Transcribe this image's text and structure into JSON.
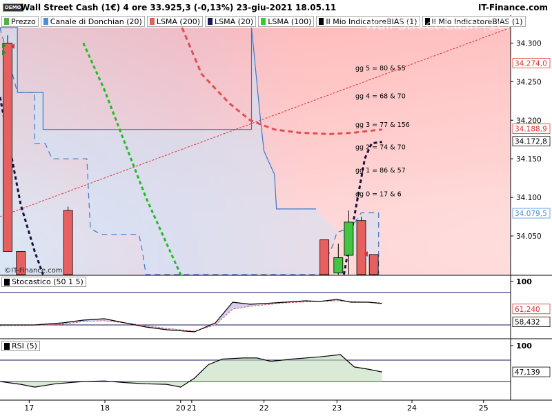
{
  "header": {
    "badge": "DEMO",
    "title": "Wall Street Cash (1€) 4 ore 33.925,3 (-0,13%) 23-giu-2021 18.05.11",
    "brand": "IT-Finance.com"
  },
  "watermark": "Wall Street Cash (1€)",
  "copyright": "©IT-Finance.com",
  "legend": [
    {
      "label": "Prezzo",
      "color": "#55b04b"
    },
    {
      "label": "Canale di Donchian (20)",
      "color": "#4a90d9"
    },
    {
      "label": "LSMA (200)",
      "color": "#e26060"
    },
    {
      "label": "LSMA (20)",
      "color": "#1a1a50"
    },
    {
      "label": "LSMA (100)",
      "color": "#33cc33"
    },
    {
      "label": "Il Mio IndicatoreBIAS (1)",
      "color": "#000000"
    },
    {
      "label": "Il Mio IndicatoreBIAS (1)",
      "color": "#000000"
    }
  ],
  "annotations": [
    {
      "text": "gg 5  = 80  & 55",
      "y": 34.268
    },
    {
      "text": "gg 4  = 68  & 70",
      "y": 34.232
    },
    {
      "text": "gg 3  = 77  & 156",
      "y": 34.195
    },
    {
      "text": "gg 2  = 74  & 70",
      "y": 34.166
    },
    {
      "text": "gg 1  = 86  & 57",
      "y": 34.136
    },
    {
      "text": "gg 0  = 17  & 6",
      "y": 34.105
    }
  ],
  "price_badges": [
    {
      "value": 34274.0,
      "label": "34.274,0",
      "color": "#e03030",
      "bg": "#ffffff"
    },
    {
      "value": 34188.9,
      "label": "34.188,9",
      "color": "#e03030",
      "bg": "#ffffff"
    },
    {
      "value": 34172.8,
      "label": "34.172,8",
      "color": "#000000",
      "bg": "#ffffff"
    },
    {
      "value": 34079.5,
      "label": "34.079,5",
      "color": "#4a90d9",
      "bg": "#ffffff"
    }
  ],
  "stoch_badges": [
    {
      "value": 61.24,
      "label": "61,240",
      "color": "#e03030"
    },
    {
      "value": 58.432,
      "label": "58,432",
      "color": "#000000"
    }
  ],
  "rsi_badges": [
    {
      "value": 47.139,
      "label": "47,139",
      "color": "#000000"
    }
  ],
  "chart_data": {
    "type": "candlestick",
    "price_axis": {
      "min": 34.0,
      "max": 34.32,
      "ticks": [
        34.05,
        34.1,
        34.15,
        34.2,
        34.25,
        34.3
      ],
      "tick_labels": [
        "34.050",
        "34.100",
        "34.150",
        "34.200",
        "34.250",
        "34.300"
      ]
    },
    "x_axis": {
      "min": 0,
      "max": 7.35,
      "ticks": [
        {
          "x": 0.42,
          "label": "17"
        },
        {
          "x": 1.51,
          "label": "18"
        },
        {
          "x": 2.6,
          "label": "20"
        },
        {
          "x": 2.76,
          "label": "21"
        },
        {
          "x": 3.8,
          "label": "22"
        },
        {
          "x": 4.85,
          "label": "23"
        },
        {
          "x": 5.93,
          "label": "24"
        },
        {
          "x": 6.96,
          "label": "25"
        }
      ]
    },
    "candles": [
      {
        "x": 0.11,
        "open": 34.3,
        "high": 34.31,
        "low": 34.03,
        "close": 34.03,
        "dir": "down"
      },
      {
        "x": 0.3,
        "open": 34.03,
        "high": 34.03,
        "low": 33.98,
        "close": 33.99,
        "dir": "down"
      },
      {
        "x": 0.98,
        "open": 34.083,
        "high": 34.088,
        "low": 33.98,
        "close": 34.0,
        "dir": "down"
      },
      {
        "x": 4.67,
        "open": 34.045,
        "high": 34.045,
        "low": 33.99,
        "close": 34.0,
        "dir": "down"
      },
      {
        "x": 4.87,
        "open": 34.002,
        "high": 34.04,
        "low": 33.99,
        "close": 34.022,
        "dir": "up"
      },
      {
        "x": 5.02,
        "open": 34.025,
        "high": 34.083,
        "low": 34.0,
        "close": 34.068,
        "dir": "up"
      },
      {
        "x": 5.2,
        "open": 34.07,
        "high": 34.075,
        "low": 33.99,
        "close": 33.995,
        "dir": "down"
      },
      {
        "x": 5.38,
        "open": 34.026,
        "high": 34.026,
        "low": 33.99,
        "close": 34.0,
        "dir": "down"
      }
    ],
    "donchian_upper": [
      [
        0.0,
        34.32
      ],
      [
        0.25,
        34.32
      ],
      [
        0.25,
        34.236
      ],
      [
        0.4,
        34.236
      ],
      [
        0.4,
        34.236
      ],
      [
        0.62,
        34.236
      ],
      [
        0.62,
        34.188
      ],
      [
        1.22,
        34.188
      ],
      [
        1.22,
        34.188
      ],
      [
        3.62,
        34.188
      ],
      [
        3.62,
        34.32
      ],
      [
        3.62,
        34.32
      ],
      [
        3.75,
        34.2
      ],
      [
        3.8,
        34.16
      ],
      [
        3.95,
        34.13
      ],
      [
        3.98,
        34.085
      ],
      [
        4.55,
        34.085
      ],
      [
        4.55,
        34.085
      ]
    ],
    "donchian_lower": [
      [
        0.0,
        34.32
      ],
      [
        0.25,
        34.236
      ],
      [
        0.25,
        34.236
      ],
      [
        0.5,
        34.236
      ],
      [
        0.5,
        34.17
      ],
      [
        0.65,
        34.17
      ],
      [
        0.75,
        34.15
      ],
      [
        1.25,
        34.15
      ],
      [
        1.3,
        34.06
      ],
      [
        1.45,
        34.052
      ],
      [
        2.0,
        34.052
      ],
      [
        2.05,
        34.03
      ],
      [
        2.1,
        34.0
      ],
      [
        4.6,
        34.0
      ],
      [
        4.8,
        34.04
      ],
      [
        4.85,
        34.055
      ],
      [
        5.05,
        34.06
      ],
      [
        5.2,
        34.08
      ],
      [
        5.45,
        34.08
      ],
      [
        5.45,
        34.0
      ]
    ],
    "lsma_200": [
      [
        2.62,
        34.32
      ],
      [
        2.9,
        34.26
      ],
      [
        3.3,
        34.222
      ],
      [
        3.6,
        34.2
      ],
      [
        3.95,
        34.188
      ],
      [
        4.3,
        34.184
      ],
      [
        4.75,
        34.182
      ],
      [
        5.1,
        34.184
      ],
      [
        5.5,
        34.188
      ]
    ],
    "lsma_20": [
      [
        0.0,
        34.23
      ],
      [
        0.15,
        34.16
      ],
      [
        0.3,
        34.09
      ],
      [
        0.5,
        34.03
      ],
      [
        0.62,
        34.0
      ]
    ],
    "lsma_20_tail": [
      [
        4.95,
        34.0
      ],
      [
        5.05,
        34.05
      ],
      [
        5.15,
        34.1
      ],
      [
        5.25,
        34.15
      ],
      [
        5.35,
        34.17
      ],
      [
        5.5,
        34.172
      ]
    ],
    "lsma_100": [
      [
        1.2,
        34.3
      ],
      [
        1.5,
        34.24
      ],
      [
        1.8,
        34.17
      ],
      [
        2.1,
        34.1
      ],
      [
        2.4,
        34.04
      ],
      [
        2.6,
        34.0
      ]
    ],
    "bias_trend": [
      [
        0.0,
        34.075
      ],
      [
        7.35,
        34.32
      ]
    ],
    "stochastic": {
      "title": "Stocastico (50 1 5)",
      "levels": [
        20,
        80
      ],
      "axis_label": "100",
      "k": [
        [
          0.0,
          45
        ],
        [
          0.5,
          45
        ],
        [
          0.9,
          48
        ],
        [
          1.2,
          52
        ],
        [
          1.5,
          54
        ],
        [
          1.8,
          48
        ],
        [
          2.1,
          42
        ],
        [
          2.4,
          38
        ],
        [
          2.8,
          35
        ],
        [
          3.1,
          48
        ],
        [
          3.35,
          78
        ],
        [
          3.6,
          75
        ],
        [
          3.8,
          76
        ],
        [
          4.1,
          78
        ],
        [
          4.4,
          80
        ],
        [
          4.6,
          79
        ],
        [
          4.85,
          82
        ],
        [
          5.05,
          78
        ],
        [
          5.3,
          78
        ],
        [
          5.5,
          76
        ]
      ],
      "d": [
        [
          0.0,
          44
        ],
        [
          0.5,
          44.5
        ],
        [
          0.9,
          46
        ],
        [
          1.2,
          50
        ],
        [
          1.5,
          51
        ],
        [
          1.8,
          48
        ],
        [
          2.1,
          44
        ],
        [
          2.4,
          40
        ],
        [
          2.8,
          36
        ],
        [
          3.1,
          45
        ],
        [
          3.35,
          68
        ],
        [
          3.6,
          72
        ],
        [
          3.8,
          74
        ],
        [
          4.1,
          77
        ],
        [
          4.4,
          78.5
        ],
        [
          4.6,
          79
        ],
        [
          4.85,
          80
        ],
        [
          5.05,
          79
        ],
        [
          5.3,
          78
        ],
        [
          5.5,
          77
        ]
      ]
    },
    "rsi": {
      "title": "RSI (5)",
      "levels": [
        30,
        70
      ],
      "axis_label": "100",
      "values": [
        [
          0.0,
          30
        ],
        [
          0.3,
          25
        ],
        [
          0.5,
          20
        ],
        [
          0.8,
          26
        ],
        [
          1.2,
          30
        ],
        [
          1.5,
          31
        ],
        [
          1.8,
          28
        ],
        [
          2.1,
          26
        ],
        [
          2.4,
          25
        ],
        [
          2.6,
          20
        ],
        [
          2.8,
          36
        ],
        [
          3.0,
          60
        ],
        [
          3.2,
          70
        ],
        [
          3.5,
          72
        ],
        [
          3.7,
          72
        ],
        [
          3.9,
          66
        ],
        [
          4.2,
          70
        ],
        [
          4.6,
          74
        ],
        [
          4.9,
          78
        ],
        [
          5.1,
          56
        ],
        [
          5.3,
          52
        ],
        [
          5.5,
          47
        ]
      ]
    }
  }
}
